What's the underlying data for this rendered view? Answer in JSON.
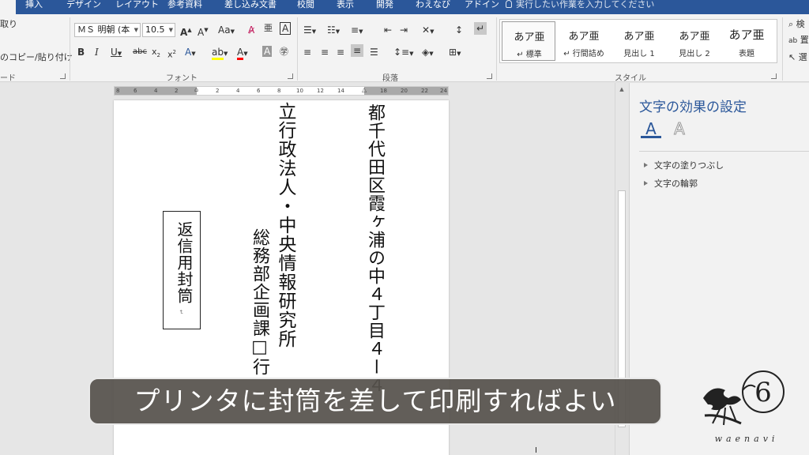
{
  "tabs": {
    "items": [
      "挿入",
      "デザイン",
      "レイアウト",
      "参考資料",
      "差し込み文書",
      "校閲",
      "表示",
      "開発",
      "わえなび",
      "アドイン"
    ],
    "tell_me": "実行したい作業を入力してください"
  },
  "clipboard": {
    "cut_label": "取り",
    "format_painter_label": "のコピー/貼り付け",
    "group_label": "ード"
  },
  "font": {
    "font_name": "ＭＳ 明朝 (本",
    "font_size": "10.5",
    "group_label": "フォント"
  },
  "paragraph": {
    "group_label": "段落"
  },
  "styles": {
    "items": [
      {
        "sample": "あア亜",
        "name": "標準"
      },
      {
        "sample": "あア亜",
        "name": "行間詰め"
      },
      {
        "sample": "あア亜",
        "name": "見出し 1"
      },
      {
        "sample": "あア亜",
        "name": "見出し 2"
      },
      {
        "sample": "あア亜",
        "name": "表題"
      }
    ],
    "group_label": "スタイル"
  },
  "editing": {
    "find_label": "検",
    "replace_label": "置",
    "select_label": "選"
  },
  "ruler": {
    "ticks": [
      "8",
      "6",
      "4",
      "2",
      "2",
      "4",
      "6",
      "8",
      "10",
      "12",
      "14",
      "18",
      "20",
      "22",
      "24"
    ]
  },
  "document": {
    "address_line": "都千代田区霞ヶ浦の中４丁目４ー４",
    "org_line": "立行政法人・中央情報研究所",
    "dept_line": "総務部企画課□行",
    "dept_mark": "↵",
    "return_label": "返信用封筒",
    "return_mark": "↵"
  },
  "pane": {
    "title": "文字の効果の設定",
    "tab_fill_glyph": "A",
    "tab_outline_glyph": "A",
    "sections": [
      "文字の塗りつぶし",
      "文字の輪郭"
    ]
  },
  "subtitle": "プリンタに封筒を差して印刷すればよい",
  "logo": {
    "mark": "6",
    "text": "waenavi"
  },
  "colors": {
    "ribbon_blue": "#2b579a",
    "pane_accent": "#2b579a",
    "highlight_yellow": "#ffff00",
    "font_color_red": "#ff0000"
  }
}
